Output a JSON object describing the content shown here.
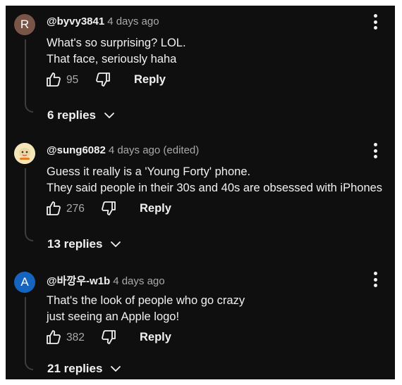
{
  "comments": [
    {
      "avatar_letter": "R",
      "avatar_color": "#795548",
      "author": "@byvy3841",
      "time": "4 days ago",
      "lines": [
        "What's so surprising? LOL.",
        "That face, seriously haha"
      ],
      "likes": "95",
      "reply_label": "Reply",
      "replies_label": "6 replies"
    },
    {
      "avatar_letter": "",
      "avatar_color": "#f5e6b8",
      "author": "@sung6082",
      "time": "4 days ago (edited)",
      "lines": [
        "Guess it really is a 'Young Forty' phone.",
        "They said people in their 30s and 40s are obsessed with iPhones"
      ],
      "likes": "276",
      "reply_label": "Reply",
      "replies_label": "13 replies"
    },
    {
      "avatar_letter": "A",
      "avatar_color": "#1565c0",
      "author": "@바깡우-w1b",
      "time": "4 days ago",
      "lines": [
        "That's the look of people who go crazy",
        "just seeing an Apple logo!"
      ],
      "likes": "382",
      "reply_label": "Reply",
      "replies_label": "21 replies"
    }
  ],
  "icons": {
    "like": "thumb-up-outline",
    "dislike": "thumb-down-outline",
    "menu": "three-dot-vertical",
    "expand": "chevron-down",
    "avatar_image": "cartoon-character-avatar"
  },
  "colors": {
    "background": "#0f0f0f",
    "text_primary": "#f1f1f1",
    "text_secondary": "#aaaaaa",
    "thread_line": "#3d3d3d"
  }
}
